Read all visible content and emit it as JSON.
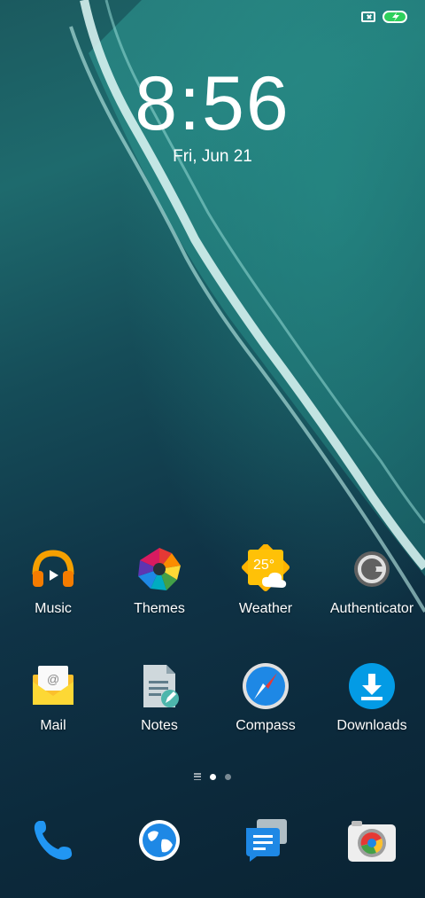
{
  "status_bar": {
    "icons": [
      "sim-error-icon",
      "battery-charging-icon"
    ],
    "battery_color": "#2fd05c"
  },
  "lockscreen": {
    "time": "8:56",
    "date": "Fri, Jun 21"
  },
  "apps": [
    {
      "label": "Music",
      "icon": "headphones-icon"
    },
    {
      "label": "Themes",
      "icon": "themes-flower-icon"
    },
    {
      "label": "Weather",
      "icon": "weather-sun-cloud-icon",
      "temp": "25°"
    },
    {
      "label": "Authenticator",
      "icon": "authenticator-icon"
    },
    {
      "label": "Mail",
      "icon": "mail-icon"
    },
    {
      "label": "Notes",
      "icon": "notes-icon"
    },
    {
      "label": "Compass",
      "icon": "compass-icon"
    },
    {
      "label": "Downloads",
      "icon": "download-icon"
    }
  ],
  "page_indicator": {
    "pages": 2,
    "current": 1
  },
  "dock": [
    {
      "icon": "phone-icon"
    },
    {
      "icon": "browser-globe-icon"
    },
    {
      "icon": "messages-icon"
    },
    {
      "icon": "camera-icon"
    }
  ]
}
